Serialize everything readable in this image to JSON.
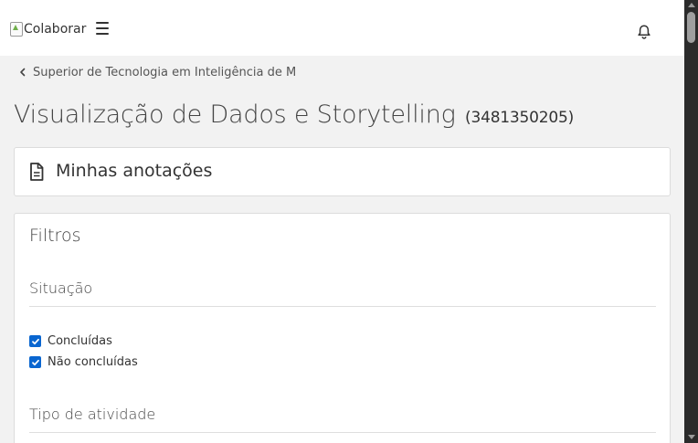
{
  "header": {
    "logo_alt": "Colaborar",
    "menu_icon": "hamburger-menu-icon",
    "notification_icon": "bell-icon"
  },
  "breadcrumb": {
    "label": "Superior de Tecnologia em Inteligência de M",
    "icon": "chevron-left-icon"
  },
  "course": {
    "title": "Visualização de Dados e Storytelling",
    "code": "(3481350205)"
  },
  "notes": {
    "label": "Minhas anotações",
    "icon": "document-icon"
  },
  "filters": {
    "title": "Filtros",
    "situacao": {
      "title": "Situação",
      "options": [
        {
          "label": "Concluídas",
          "checked": true
        },
        {
          "label": "Não concluídas",
          "checked": true
        }
      ]
    },
    "tipo_atividade": {
      "title": "Tipo de atividade"
    }
  },
  "colors": {
    "accent": "#0a66d0",
    "scrollbar_track": "#2b2b2b",
    "page_background": "#f2f2f2"
  }
}
